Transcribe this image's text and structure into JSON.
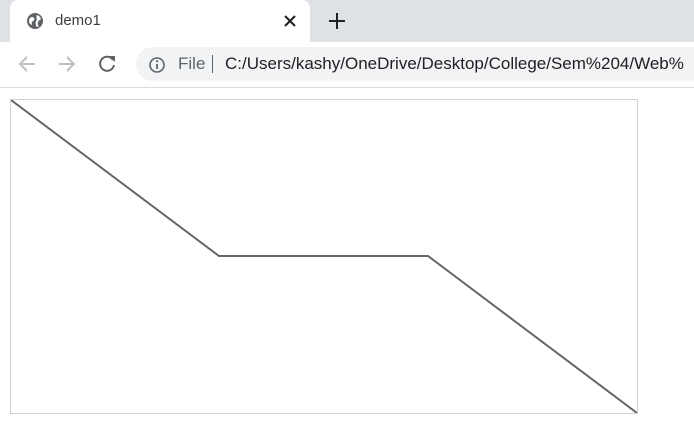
{
  "tab": {
    "title": "demo1",
    "favicon": "globe-icon",
    "close_icon": "close-icon"
  },
  "toolbar": {
    "new_tab_icon": "plus-icon",
    "back_icon": "arrow-left-icon",
    "forward_icon": "arrow-right-icon",
    "reload_icon": "reload-icon"
  },
  "address_bar": {
    "scheme_label": "File",
    "url": "C:/Users/kashy/OneDrive/Desktop/College/Sem%204/Web%",
    "info_icon": "info-icon"
  },
  "colors": {
    "tabstrip": "#dee1e6",
    "omnibox": "#f1f3f4",
    "line": "#666666",
    "canvas_border": "#d0d0d0"
  }
}
